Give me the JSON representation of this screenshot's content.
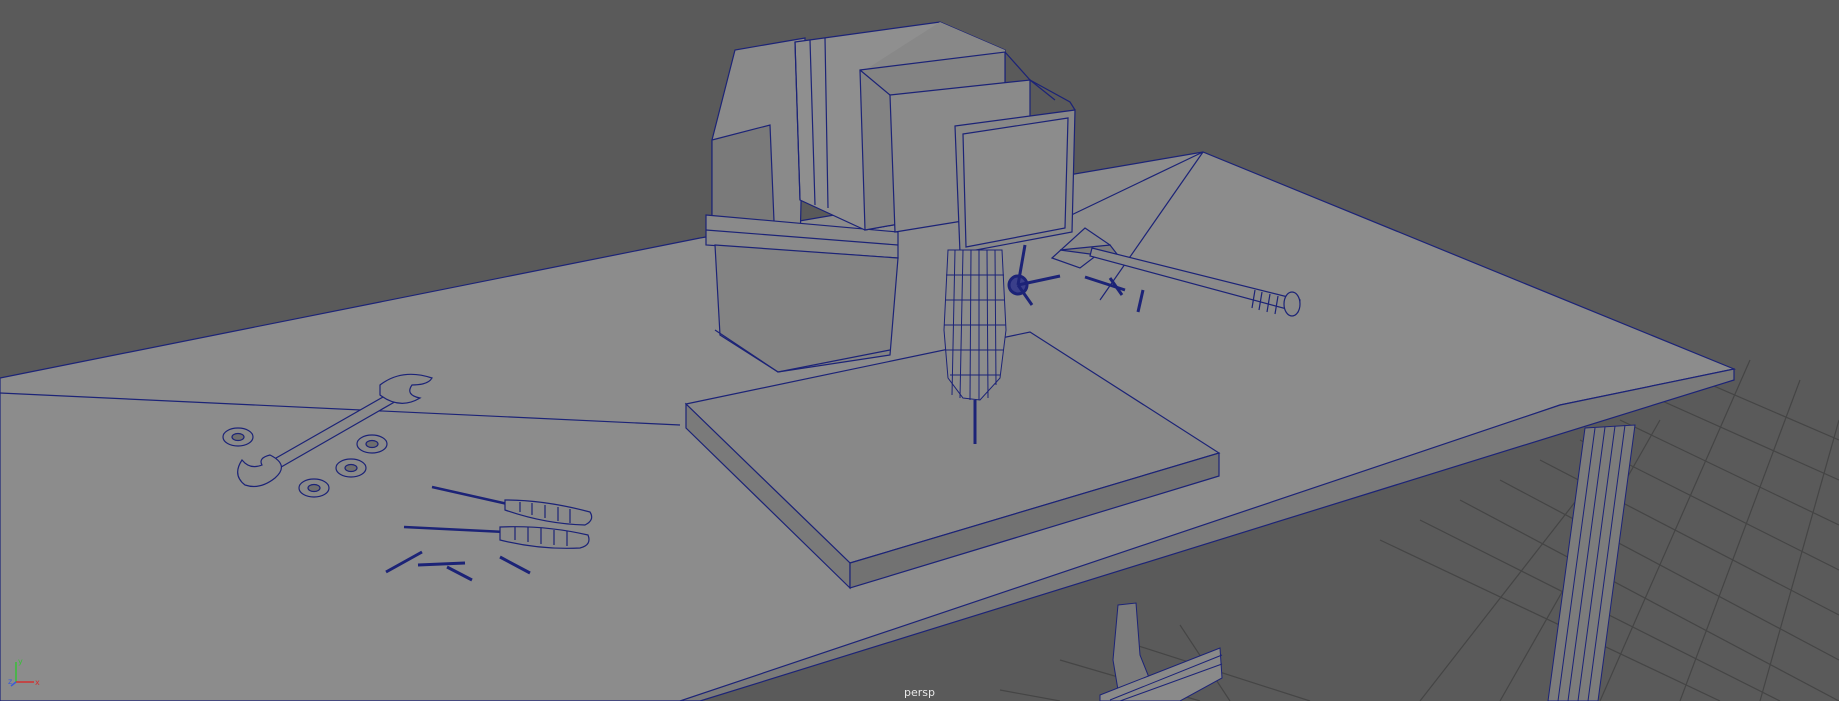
{
  "viewport": {
    "camera_name": "persp",
    "axis_labels": {
      "x": "x",
      "y": "y",
      "z": "z"
    },
    "colors": {
      "background": "#5a5a5a",
      "grid": "#474747",
      "surface": "#8c8c8c",
      "surface_dark": "#6e6e6e",
      "wire": "#1c2377",
      "axis_x": "#d23030",
      "axis_y": "#37c037",
      "axis_z": "#3b5bd6"
    }
  }
}
